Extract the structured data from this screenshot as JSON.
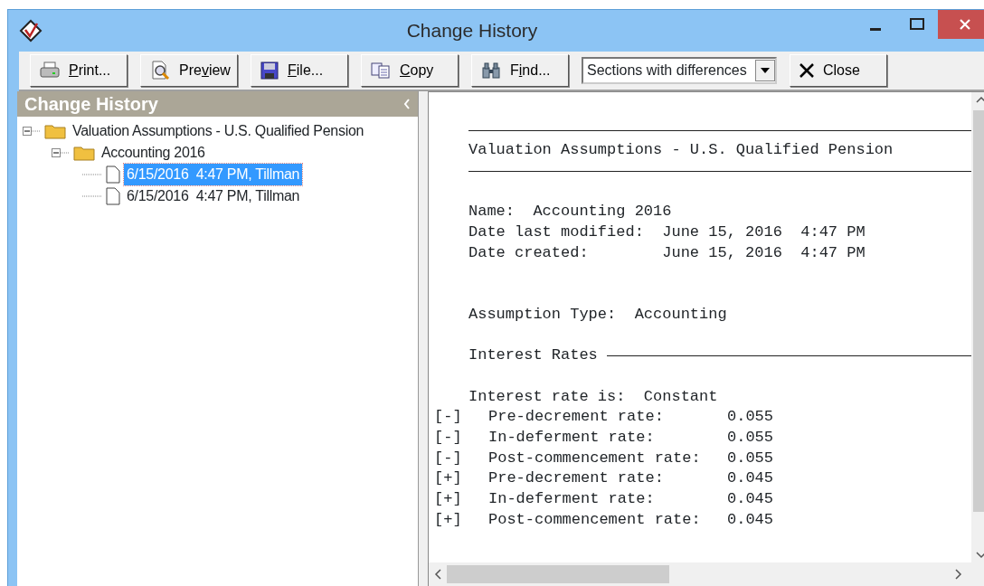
{
  "window": {
    "title": "Change History"
  },
  "toolbar": {
    "buttons": [
      {
        "kind": "print",
        "access_key": "P",
        "label_rest": "rint..."
      },
      {
        "kind": "preview",
        "label_start": "Pre",
        "access_key": "v",
        "label_rest": "iew"
      },
      {
        "kind": "file",
        "access_key": "F",
        "label_rest": "ile..."
      },
      {
        "kind": "copy",
        "access_key": "C",
        "label_rest": "opy"
      },
      {
        "kind": "find",
        "label_start": "F",
        "access_key": "i",
        "label_rest": "nd..."
      }
    ],
    "view_select": {
      "value": "Sections with differences"
    },
    "close_button": {
      "label": "Close"
    }
  },
  "sidebar": {
    "title": "Change History",
    "tree": [
      {
        "kind": "folder",
        "label": "Valuation Assumptions - U.S. Qualified Pension",
        "expanded": true,
        "selected": false,
        "children": [
          {
            "kind": "folder",
            "label": "Accounting 2016",
            "expanded": true,
            "selected": false,
            "children": [
              {
                "kind": "document",
                "label": "6/15/2016  4:47 PM, Tillman",
                "selected": true
              },
              {
                "kind": "document",
                "label": "6/15/2016  4:47 PM, Tillman",
                "selected": false
              }
            ]
          }
        ]
      }
    ]
  },
  "report": {
    "lines": [
      {
        "kind": "blank"
      },
      {
        "kind": "rule"
      },
      {
        "kind": "text",
        "text": "Valuation Assumptions - U.S. Qualified Pension"
      },
      {
        "kind": "rule"
      },
      {
        "kind": "blank"
      },
      {
        "kind": "text",
        "text": "Name:  Accounting 2016"
      },
      {
        "kind": "text",
        "text": "Date last modified:  June 15, 2016  4:47 PM"
      },
      {
        "kind": "text",
        "text": "Date created:        June 15, 2016  4:47 PM"
      },
      {
        "kind": "blank"
      },
      {
        "kind": "blank"
      },
      {
        "kind": "text",
        "text": "Assumption Type:  Accounting"
      },
      {
        "kind": "blank"
      },
      {
        "kind": "section",
        "text": "Interest Rates"
      },
      {
        "kind": "blank"
      },
      {
        "kind": "text",
        "text": "Interest rate is:  Constant"
      },
      {
        "kind": "diff",
        "marker": "[-]",
        "label": "Pre-decrement rate:",
        "value": "0.055"
      },
      {
        "kind": "diff",
        "marker": "[-]",
        "label": "In-deferment rate:",
        "value": "0.055"
      },
      {
        "kind": "diff",
        "marker": "[-]",
        "label": "Post-commencement rate:",
        "value": "0.055"
      },
      {
        "kind": "diff",
        "marker": "[+]",
        "label": "Pre-decrement rate:",
        "value": "0.045"
      },
      {
        "kind": "diff",
        "marker": "[+]",
        "label": "In-deferment rate:",
        "value": "0.045"
      },
      {
        "kind": "diff",
        "marker": "[+]",
        "label": "Post-commencement rate:",
        "value": "0.045"
      }
    ]
  }
}
